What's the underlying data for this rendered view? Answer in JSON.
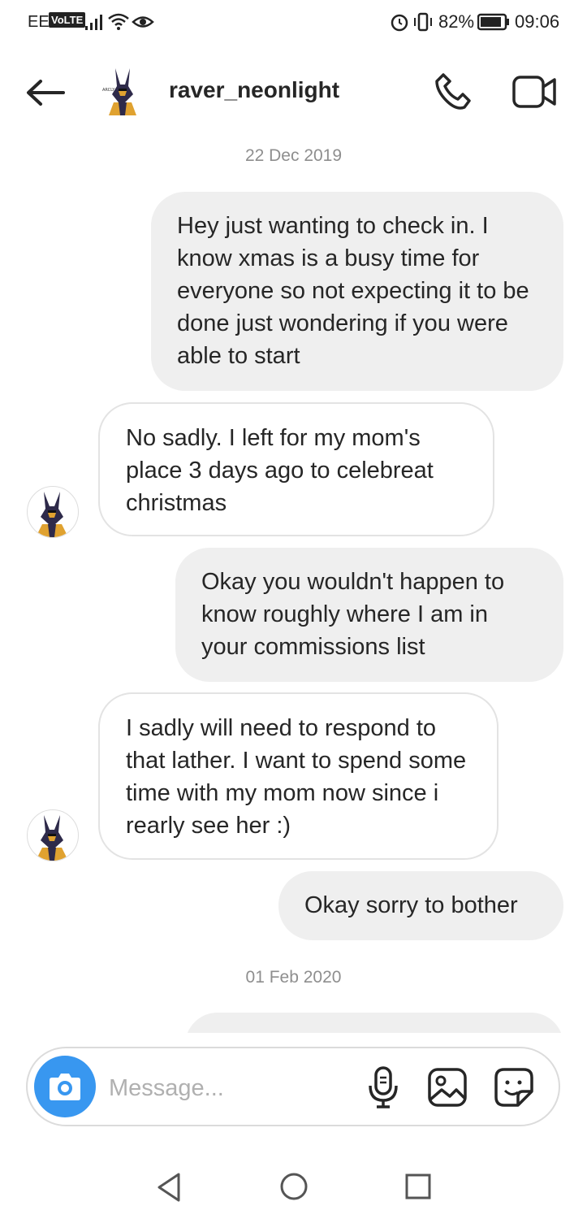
{
  "status_bar": {
    "carrier": "EE",
    "volte": "VoLTE",
    "battery": "82%",
    "time": "09:06"
  },
  "header": {
    "username": "raver_neonlight",
    "icons": [
      "back-arrow-icon",
      "phone-icon",
      "video-camera-icon"
    ]
  },
  "conversation": {
    "date_1": "22 Dec 2019",
    "date_2": "01 Feb 2020",
    "messages": [
      {
        "from": "me",
        "text": "Hey just wanting to check in. I know xmas is a busy time for everyone so not expecting it to be done just wondering if you were able to start"
      },
      {
        "from": "them",
        "text": "No sadly. I left for my mom's place 3 days ago to celebreat christmas"
      },
      {
        "from": "me",
        "text": "Okay you wouldn't happen to know roughly where I am in your commissions list"
      },
      {
        "from": "them",
        "text": "I sadly will need to respond to that lather. I want to spend some time with my mom now since i rearly see her :)"
      },
      {
        "from": "me",
        "text": "Okay sorry to bother"
      }
    ]
  },
  "composer": {
    "placeholder": "Message...",
    "icons": [
      "camera-icon",
      "microphone-icon",
      "gallery-icon",
      "sticker-icon"
    ]
  },
  "navigation": {
    "icons": [
      "back-triangle-icon",
      "home-circle-icon",
      "recents-square-icon"
    ]
  },
  "colors": {
    "accent_blue": "#3897f0",
    "outgoing_bubble": "#efefef",
    "incoming_border": "#e3e3e3",
    "date_text": "#8e8e8e"
  }
}
